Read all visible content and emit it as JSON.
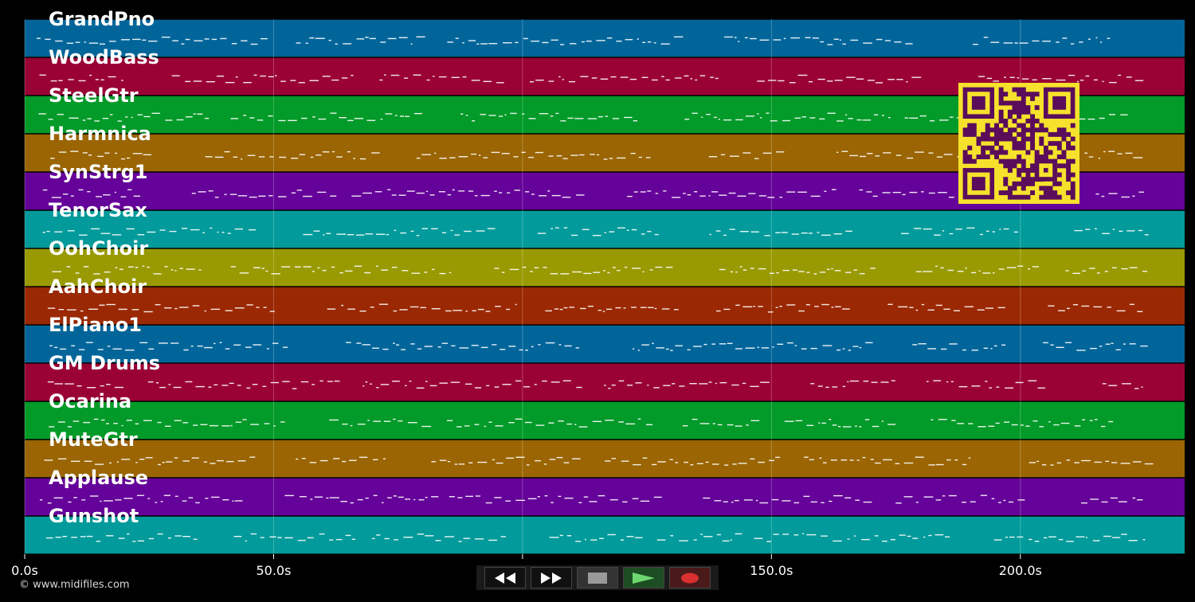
{
  "timeline": {
    "duration_s": 233,
    "tracks": [
      {
        "name": "GrandPno",
        "color": "#02659a"
      },
      {
        "name": "WoodBass",
        "color": "#9a0235"
      },
      {
        "name": "SteelGtr",
        "color": "#029a28"
      },
      {
        "name": "Harmnica",
        "color": "#9a6502"
      },
      {
        "name": "SynStrg1",
        "color": "#650299"
      },
      {
        "name": "TenorSax",
        "color": "#029a9a"
      },
      {
        "name": "OohChoir",
        "color": "#999a02"
      },
      {
        "name": "AahChoir",
        "color": "#9a2802"
      },
      {
        "name": "ElPiano1",
        "color": "#02659a"
      },
      {
        "name": "GM Drums",
        "color": "#9a0235"
      },
      {
        "name": "Ocarina",
        "color": "#029a28"
      },
      {
        "name": "MuteGtr",
        "color": "#9a6502"
      },
      {
        "name": "Applause",
        "color": "#650299"
      },
      {
        "name": "Gunshot",
        "color": "#029a9a"
      }
    ],
    "ticks": [
      {
        "t": 0,
        "label": "0.0s"
      },
      {
        "t": 50,
        "label": "50.0s"
      },
      {
        "t": 100,
        "label": "100.0s"
      },
      {
        "t": 150,
        "label": "150.0s"
      },
      {
        "t": 200,
        "label": "200.0s"
      }
    ]
  },
  "qr": {
    "color_bg": "#f6e22c",
    "color_fg": "#5a0d5a"
  },
  "footer": {
    "copyright": "© www.midifiles.com"
  },
  "controls": {
    "rewind_icon": "rewind-icon",
    "forward_icon": "fast-forward-icon",
    "stop_icon": "stop-icon",
    "play_icon": "play-icon",
    "record_icon": "record-icon"
  }
}
